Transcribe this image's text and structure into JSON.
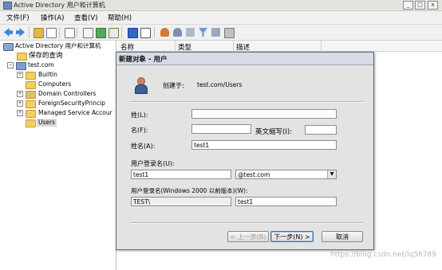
{
  "window": {
    "title": "Active Directory 用户和计算机",
    "controls": {
      "minimize": "_",
      "maximize": "□",
      "close": "x"
    }
  },
  "menu": {
    "file": "文件(F)",
    "action": "操作(A)",
    "view": "查看(V)",
    "help": "帮助(H)"
  },
  "tree": {
    "root": "Active Directory 用户和计算机",
    "saved_queries": "保存的查询",
    "domain": "test.com",
    "children": [
      "Builtin",
      "Computers",
      "Domain Controllers",
      "ForeignSecurityPrincip",
      "Managed Service Accour",
      "Users"
    ]
  },
  "list": {
    "columns": [
      "名称",
      "类型",
      "描述"
    ]
  },
  "dialog": {
    "title": "新建对象 - 用户",
    "create_in_label": "创建于:",
    "create_in_value": "test.com/Users",
    "last_name_label": "姓(L):",
    "last_name_value": "",
    "first_name_label": "名(F):",
    "first_name_value": "",
    "initials_label": "英文缩写(I):",
    "initials_value": "",
    "full_name_label": "姓名(A):",
    "full_name_value": "test1",
    "logon_name_label": "用户登录名(U):",
    "logon_name_value": "test1",
    "upn_suffix_value": "@test.com",
    "pre2000_label": "用户登录名(Windows 2000 以前版本)(W):",
    "pre2000_domain": "TEST\\",
    "pre2000_value": "test1",
    "back_button": "< 上一步(B)",
    "next_button": "下一步(N) >",
    "cancel_button": "取消"
  },
  "watermark": "https://blog.csdn.net/lq56789"
}
